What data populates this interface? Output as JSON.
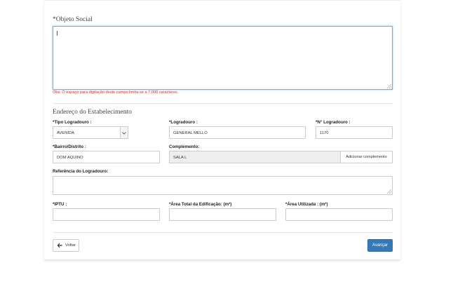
{
  "objeto_social": {
    "label": "*Objeto Social",
    "value": "",
    "note": "Obs: O espaço para digitação deste campo limita-se a 7,000 caracteres."
  },
  "endereco": {
    "section_title": "Endereço do Estabelecimento",
    "tipo_logradouro": {
      "label": "*Tipo Logradouro :",
      "value": "AVENIDA"
    },
    "logradouro": {
      "label": "*Logradouro :",
      "value": "GENERAL MELLO"
    },
    "numero": {
      "label": "*N° Logradouro :",
      "value": "1170"
    },
    "bairro": {
      "label": "*Bairro/Distrito :",
      "value": "DOM AQUINO"
    },
    "complemento": {
      "label": "Complemento:",
      "value": "SALA L",
      "button": "Adicionar complemento"
    },
    "referencia": {
      "label": "Referência do Logradouro:",
      "value": ""
    },
    "iptu": {
      "label": "*IPTU :",
      "value": ""
    },
    "area_total": {
      "label": "*Área Total da Edificação: (m²)",
      "value": ""
    },
    "area_utilizada": {
      "label": "*Área Utilizada : (m²)",
      "value": ""
    }
  },
  "actions": {
    "back": "Voltar",
    "next": "Avançar"
  },
  "colors": {
    "primary_button": "#3579b8",
    "note_text": "#c9302c",
    "focus_border": "#66afe9"
  }
}
